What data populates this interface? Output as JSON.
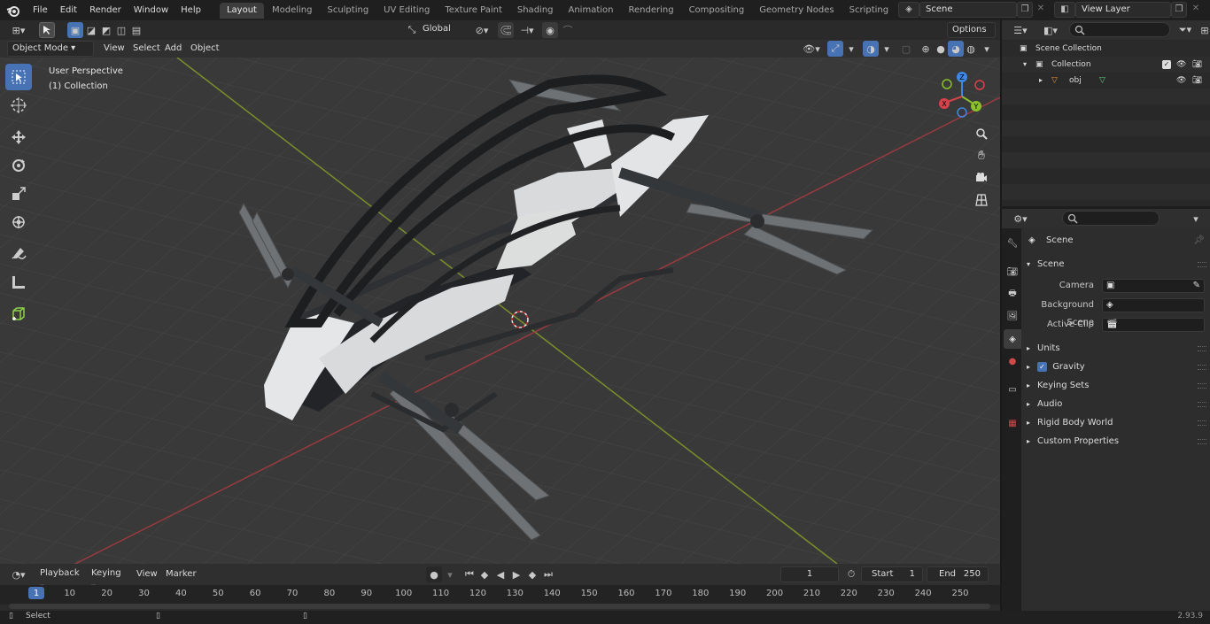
{
  "topbar": {
    "menus": [
      "File",
      "Edit",
      "Render",
      "Window",
      "Help"
    ],
    "workspaces": [
      "Layout",
      "Modeling",
      "Sculpting",
      "UV Editing",
      "Texture Paint",
      "Shading",
      "Animation",
      "Rendering",
      "Compositing",
      "Geometry Nodes",
      "Scripting"
    ],
    "active_workspace": "Layout",
    "scene_name": "Scene",
    "view_layer": "View Layer"
  },
  "viewport_header": {
    "mode": "Object Mode",
    "menus": [
      "View",
      "Select",
      "Add",
      "Object"
    ],
    "transform_orientation": "Global",
    "options_label": "Options"
  },
  "viewport": {
    "perspective_label": "User Perspective",
    "collection_label": "(1) Collection",
    "axes": {
      "x": "X",
      "y": "Y",
      "z": "Z"
    },
    "colors": {
      "x": "#d7434a",
      "y": "#8bbf2c",
      "z": "#3f86e6",
      "grid": "#444444",
      "background": "#3b3b3b"
    }
  },
  "timeline": {
    "menus": [
      "Playback",
      "Keying",
      "View",
      "Marker"
    ],
    "current_frame": "1",
    "start_label": "Start",
    "start_value": "1",
    "end_label": "End",
    "end_value": "250",
    "ticks": [
      "1",
      "10",
      "20",
      "30",
      "40",
      "50",
      "60",
      "70",
      "80",
      "90",
      "100",
      "110",
      "120",
      "130",
      "140",
      "150",
      "160",
      "170",
      "180",
      "190",
      "200",
      "210",
      "220",
      "230",
      "240",
      "250"
    ]
  },
  "outliner": {
    "root": "Scene Collection",
    "collection": "Collection",
    "object": "obj"
  },
  "properties": {
    "context_title": "Scene",
    "panel_title": "Scene",
    "fields": [
      {
        "label": "Camera"
      },
      {
        "label": "Background Scene"
      },
      {
        "label": "Active Clip"
      }
    ],
    "subpanels": [
      "Units",
      "Gravity",
      "Keying Sets",
      "Audio",
      "Rigid Body World",
      "Custom Properties"
    ]
  },
  "status": {
    "left": "Select",
    "version": "2.93.9"
  }
}
